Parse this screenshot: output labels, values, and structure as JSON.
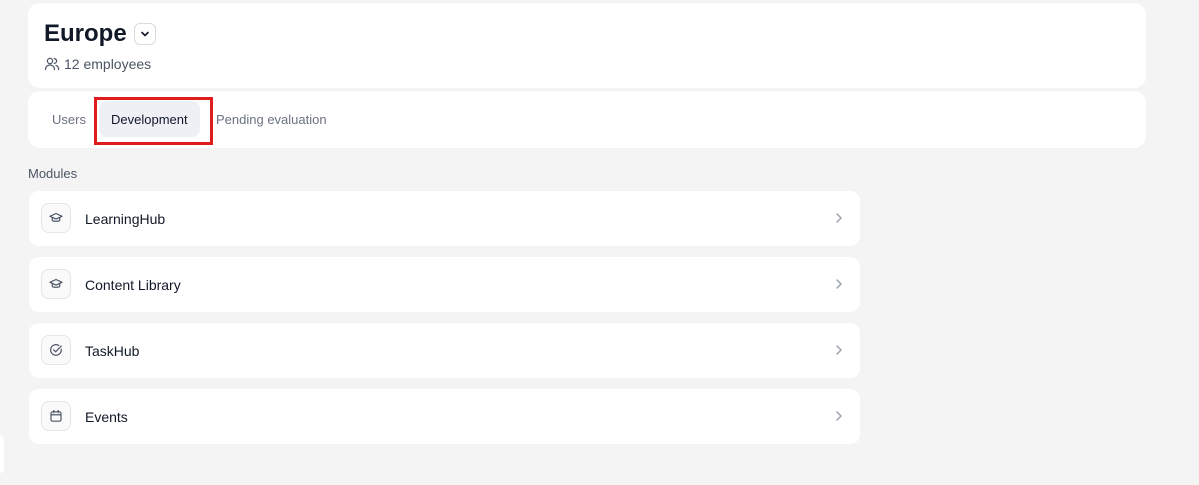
{
  "group": {
    "title": "Europe",
    "employee_count": "12 employees"
  },
  "tabs": [
    {
      "label": "Users",
      "active": false
    },
    {
      "label": "Development",
      "active": true
    },
    {
      "label": "Pending evaluation",
      "active": false
    }
  ],
  "modules_heading": "Modules",
  "modules": [
    {
      "label": "LearningHub",
      "icon": "graduation-cap-icon"
    },
    {
      "label": "Content Library",
      "icon": "graduation-cap-icon"
    },
    {
      "label": "TaskHub",
      "icon": "check-circle-icon"
    },
    {
      "label": "Events",
      "icon": "calendar-icon"
    }
  ],
  "colors": {
    "highlight": "#e01c1c",
    "background": "#f4f4f4",
    "active_tab_bg": "#eef0f5"
  }
}
